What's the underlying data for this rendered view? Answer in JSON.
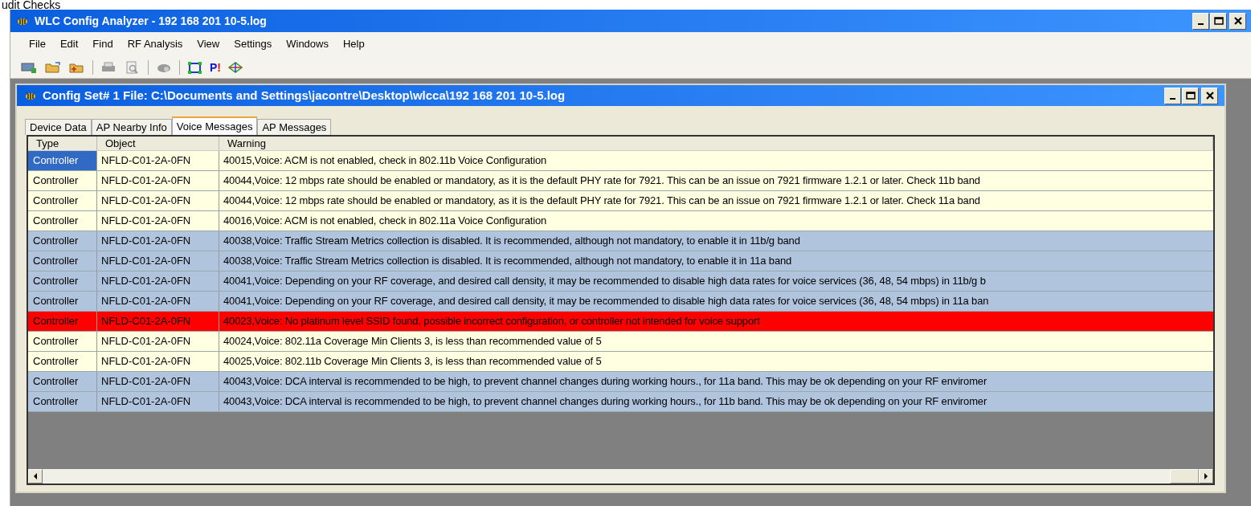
{
  "slide_title": "udit Checks",
  "window": {
    "title": "WLC Config Analyzer - 192 168 201 10-5.log"
  },
  "menu": [
    "File",
    "Edit",
    "Find",
    "RF Analysis",
    "View",
    "Settings",
    "Windows",
    "Help"
  ],
  "toolbar": [
    {
      "kind": "new",
      "disabled": false
    },
    {
      "kind": "open",
      "disabled": false
    },
    {
      "kind": "add",
      "disabled": false
    },
    {
      "kind": "separator"
    },
    {
      "kind": "print",
      "disabled": true
    },
    {
      "kind": "preview",
      "disabled": true
    },
    {
      "kind": "separator"
    },
    {
      "kind": "disk",
      "disabled": true
    },
    {
      "kind": "separator"
    },
    {
      "kind": "frame",
      "disabled": false
    },
    {
      "kind": "letters",
      "parts": [
        "P",
        "!"
      ],
      "disabled": false
    },
    {
      "kind": "network",
      "disabled": false
    }
  ],
  "child_window": {
    "title": "Config Set# 1 File: C:\\Documents and Settings\\jacontre\\Desktop\\wlcca\\192 168 201 10-5.log"
  },
  "tabs": [
    {
      "label": "Device Data",
      "selected": false
    },
    {
      "label": "AP Nearby Info",
      "selected": false
    },
    {
      "label": "Voice Messages",
      "selected": true
    },
    {
      "label": "AP Messages",
      "selected": false
    }
  ],
  "table": {
    "columns": [
      "Type",
      "Object",
      "Warning"
    ],
    "rows": [
      {
        "type": "Controller",
        "object": "NFLD-C01-2A-0FN",
        "warning": "40015,Voice: ACM is not enabled, check in 802.11b Voice Configuration",
        "color": "#ffffe1",
        "selected": true
      },
      {
        "type": "Controller",
        "object": "NFLD-C01-2A-0FN",
        "warning": "40044,Voice: 12 mbps rate should be enabled or mandatory, as it is the default PHY rate for 7921. This can be an issue on 7921 firmware 1.2.1 or later. Check 11b band",
        "color": "#ffffe1",
        "selected": false
      },
      {
        "type": "Controller",
        "object": "NFLD-C01-2A-0FN",
        "warning": "40044,Voice: 12 mbps rate should be enabled or mandatory, as it is the default PHY rate for 7921. This can be an issue on 7921 firmware 1.2.1 or later. Check 11a band",
        "color": "#ffffe1",
        "selected": false
      },
      {
        "type": "Controller",
        "object": "NFLD-C01-2A-0FN",
        "warning": "40016,Voice: ACM is not enabled, check in 802.11a Voice Configuration",
        "color": "#ffffe1",
        "selected": false
      },
      {
        "type": "Controller",
        "object": "NFLD-C01-2A-0FN",
        "warning": "40038,Voice: Traffic Stream Metrics collection is disabled. It is recommended, although not mandatory, to enable it in 11b/g band",
        "color": "#b0c4de",
        "selected": false
      },
      {
        "type": "Controller",
        "object": "NFLD-C01-2A-0FN",
        "warning": "40038,Voice: Traffic Stream Metrics collection is disabled. It is recommended, although not mandatory, to enable it in 11a band",
        "color": "#b0c4de",
        "selected": false
      },
      {
        "type": "Controller",
        "object": "NFLD-C01-2A-0FN",
        "warning": "40041,Voice: Depending on your RF coverage, and desired call density, it may be recommended to disable high data rates for voice services (36, 48, 54 mbps) in 11b/g b",
        "color": "#b0c4de",
        "selected": false
      },
      {
        "type": "Controller",
        "object": "NFLD-C01-2A-0FN",
        "warning": "40041,Voice: Depending on your RF coverage, and desired call density, it may be recommended to disable high data rates for voice services (36, 48, 54 mbps) in 11a ban",
        "color": "#b0c4de",
        "selected": false
      },
      {
        "type": "Controller",
        "object": "NFLD-C01-2A-0FN",
        "warning": "40023,Voice: No platinum level SSID found, possible incorrect configuration, or controller not intended for voice support",
        "color": "#ff0000",
        "selected": false
      },
      {
        "type": "Controller",
        "object": "NFLD-C01-2A-0FN",
        "warning": "40024,Voice: 802.11a Coverage Min Clients 3,  is less than recommended value of 5",
        "color": "#ffffe1",
        "selected": false
      },
      {
        "type": "Controller",
        "object": "NFLD-C01-2A-0FN",
        "warning": "40025,Voice: 802.11b Coverage Min Clients 3,  is less than recommended value of 5",
        "color": "#ffffe1",
        "selected": false
      },
      {
        "type": "Controller",
        "object": "NFLD-C01-2A-0FN",
        "warning": "40043,Voice: DCA interval is recommended to be high, to prevent channel changes during working hours., for 11a band. This may be ok depending on your RF enviromer",
        "color": "#b0c4de",
        "selected": false
      },
      {
        "type": "Controller",
        "object": "NFLD-C01-2A-0FN",
        "warning": "40043,Voice: DCA interval is recommended to be high, to prevent channel changes during working hours., for 11b band. This may be ok depending on your RF enviromer",
        "color": "#b0c4de",
        "selected": false
      }
    ]
  }
}
